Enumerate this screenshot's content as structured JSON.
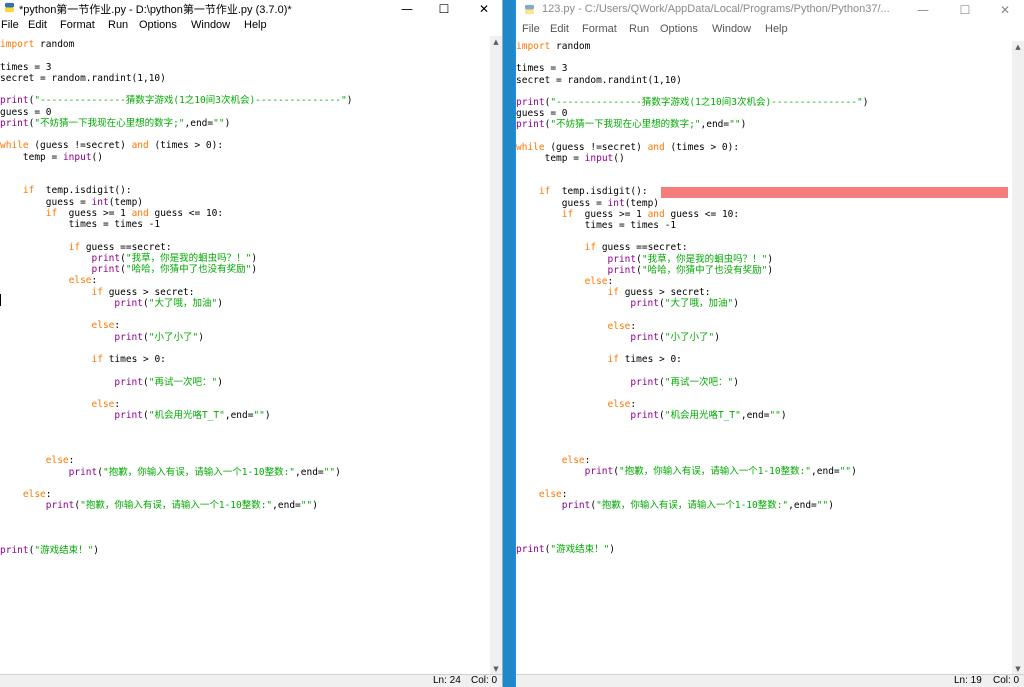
{
  "left_window": {
    "title": "*python第一节作业.py - D:\\python第一节作业.py (3.7.0)*",
    "menu": [
      "File",
      "Edit",
      "Format",
      "Run",
      "Options",
      "Window",
      "Help"
    ],
    "status_ln": "Ln: 24",
    "status_col": "Col: 0"
  },
  "right_window": {
    "title": "123.py - C:/Users/QWork/AppData/Local/Programs/Python/Python37/...",
    "menu": [
      "File",
      "Edit",
      "Format",
      "Run",
      "Options",
      "Window",
      "Help"
    ],
    "status_ln": "Ln: 19",
    "status_col": "Col: 0"
  },
  "window_controls": {
    "minimize": "—",
    "maximize": "☐",
    "close": "✕"
  },
  "scroll_arrows": {
    "up": "▲",
    "down": "▼"
  },
  "code_left": [
    {
      "indent": 0,
      "tokens": [
        [
          "kw",
          "import"
        ],
        [
          "n",
          " random"
        ]
      ]
    },
    {
      "indent": 0,
      "tokens": []
    },
    {
      "indent": 0,
      "tokens": [
        [
          "n",
          "times = 3"
        ]
      ]
    },
    {
      "indent": 0,
      "tokens": [
        [
          "n",
          "secret = random.randint(1,10)"
        ]
      ]
    },
    {
      "indent": 0,
      "tokens": []
    },
    {
      "indent": 0,
      "tokens": [
        [
          "bi",
          "print"
        ],
        [
          "n",
          "("
        ],
        [
          "st",
          "\"---------------猜数字游戏(1之10间3次机会)---------------\""
        ],
        [
          "n",
          ")"
        ]
      ]
    },
    {
      "indent": 0,
      "tokens": [
        [
          "n",
          "guess = 0"
        ]
      ]
    },
    {
      "indent": 0,
      "tokens": [
        [
          "bi",
          "print"
        ],
        [
          "n",
          "("
        ],
        [
          "st",
          "\"不妨猜一下我现在心里想的数字;\""
        ],
        [
          "n",
          ",end="
        ],
        [
          "st",
          "\"\""
        ],
        [
          "n",
          ")"
        ]
      ]
    },
    {
      "indent": 0,
      "tokens": []
    },
    {
      "indent": 0,
      "tokens": [
        [
          "kw",
          "while"
        ],
        [
          "n",
          " (guess !=secret) "
        ],
        [
          "kw",
          "and"
        ],
        [
          "n",
          " (times > 0):"
        ]
      ]
    },
    {
      "indent": 4,
      "tokens": [
        [
          "n",
          "temp = "
        ],
        [
          "bi",
          "input"
        ],
        [
          "n",
          "()"
        ]
      ]
    },
    {
      "indent": 0,
      "tokens": []
    },
    {
      "indent": 0,
      "tokens": []
    },
    {
      "indent": 4,
      "tokens": [
        [
          "kw",
          "if"
        ],
        [
          "n",
          "  temp.isdigit():"
        ]
      ]
    },
    {
      "indent": 8,
      "tokens": [
        [
          "n",
          "guess = "
        ],
        [
          "bi",
          "int"
        ],
        [
          "n",
          "(temp)"
        ]
      ]
    },
    {
      "indent": 8,
      "tokens": [
        [
          "kw",
          "if"
        ],
        [
          "n",
          "  guess >= 1 "
        ],
        [
          "kw",
          "and"
        ],
        [
          "n",
          " guess <= 10:"
        ]
      ]
    },
    {
      "indent": 12,
      "tokens": [
        [
          "n",
          "times = times -1"
        ]
      ]
    },
    {
      "indent": 0,
      "tokens": []
    },
    {
      "indent": 12,
      "tokens": [
        [
          "kw",
          "if"
        ],
        [
          "n",
          " guess ==secret:"
        ]
      ]
    },
    {
      "indent": 16,
      "tokens": [
        [
          "bi",
          "print"
        ],
        [
          "n",
          "("
        ],
        [
          "st",
          "\"我草，你是我的蛔虫吗？！\""
        ],
        [
          "n",
          ")"
        ]
      ]
    },
    {
      "indent": 16,
      "tokens": [
        [
          "bi",
          "print"
        ],
        [
          "n",
          "("
        ],
        [
          "st",
          "\"哈哈，你猜中了也没有奖励\""
        ],
        [
          "n",
          ")"
        ]
      ]
    },
    {
      "indent": 12,
      "tokens": [
        [
          "kw",
          "else"
        ],
        [
          "n",
          ":"
        ]
      ]
    },
    {
      "indent": 16,
      "tokens": [
        [
          "kw",
          "if"
        ],
        [
          "n",
          " guess > secret:"
        ]
      ]
    },
    {
      "indent": 20,
      "tokens": [
        [
          "bi",
          "print"
        ],
        [
          "n",
          "("
        ],
        [
          "st",
          "\"大了哦，加油\""
        ],
        [
          "n",
          ")"
        ]
      ]
    },
    {
      "indent": 0,
      "tokens": []
    },
    {
      "indent": 16,
      "tokens": [
        [
          "kw",
          "else"
        ],
        [
          "n",
          ":"
        ]
      ]
    },
    {
      "indent": 20,
      "tokens": [
        [
          "bi",
          "print"
        ],
        [
          "n",
          "("
        ],
        [
          "st",
          "\"小了小了\""
        ],
        [
          "n",
          ")"
        ]
      ]
    },
    {
      "indent": 0,
      "tokens": []
    },
    {
      "indent": 16,
      "tokens": [
        [
          "kw",
          "if"
        ],
        [
          "n",
          " times > 0:"
        ]
      ]
    },
    {
      "indent": 0,
      "tokens": []
    },
    {
      "indent": 20,
      "tokens": [
        [
          "bi",
          "print"
        ],
        [
          "n",
          "("
        ],
        [
          "st",
          "\"再试一次吧：\""
        ],
        [
          "n",
          ")"
        ]
      ]
    },
    {
      "indent": 0,
      "tokens": []
    },
    {
      "indent": 16,
      "tokens": [
        [
          "kw",
          "else"
        ],
        [
          "n",
          ":"
        ]
      ]
    },
    {
      "indent": 20,
      "tokens": [
        [
          "bi",
          "print"
        ],
        [
          "n",
          "("
        ],
        [
          "st",
          "\"机会用光咯T_T\""
        ],
        [
          "n",
          ",end="
        ],
        [
          "st",
          "\"\""
        ],
        [
          "n",
          ")"
        ]
      ]
    },
    {
      "indent": 0,
      "tokens": []
    },
    {
      "indent": 0,
      "tokens": []
    },
    {
      "indent": 0,
      "tokens": []
    },
    {
      "indent": 8,
      "tokens": [
        [
          "kw",
          "else"
        ],
        [
          "n",
          ":"
        ]
      ]
    },
    {
      "indent": 12,
      "tokens": [
        [
          "bi",
          "print"
        ],
        [
          "n",
          "("
        ],
        [
          "st",
          "\"抱歉，你输入有误，请输入一个1-10整数:\""
        ],
        [
          "n",
          ",end="
        ],
        [
          "st",
          "\"\""
        ],
        [
          "n",
          ")"
        ]
      ]
    },
    {
      "indent": 0,
      "tokens": []
    },
    {
      "indent": 4,
      "tokens": [
        [
          "kw",
          "else"
        ],
        [
          "n",
          ":"
        ]
      ]
    },
    {
      "indent": 8,
      "tokens": [
        [
          "bi",
          "print"
        ],
        [
          "n",
          "("
        ],
        [
          "st",
          "\"抱歉，你输入有误，请输入一个1-10整数:\""
        ],
        [
          "n",
          ",end="
        ],
        [
          "st",
          "\"\""
        ],
        [
          "n",
          ")"
        ]
      ]
    },
    {
      "indent": 0,
      "tokens": []
    },
    {
      "indent": 0,
      "tokens": []
    },
    {
      "indent": 0,
      "tokens": []
    },
    {
      "indent": 0,
      "tokens": [
        [
          "bi",
          "print"
        ],
        [
          "n",
          "("
        ],
        [
          "st",
          "\"游戏结束！\""
        ],
        [
          "n",
          ")"
        ]
      ]
    }
  ],
  "code_right": [
    {
      "indent": 0,
      "tokens": [
        [
          "kw",
          "import"
        ],
        [
          "n",
          " random"
        ]
      ]
    },
    {
      "indent": 0,
      "tokens": []
    },
    {
      "indent": 0,
      "tokens": [
        [
          "n",
          "times = 3"
        ]
      ]
    },
    {
      "indent": 0,
      "tokens": [
        [
          "n",
          "secret = random.randint(1,10)"
        ]
      ]
    },
    {
      "indent": 0,
      "tokens": []
    },
    {
      "indent": 0,
      "tokens": [
        [
          "bi",
          "print"
        ],
        [
          "n",
          "("
        ],
        [
          "st",
          "\"---------------猜数字游戏(1之10间3次机会)---------------\""
        ],
        [
          "n",
          ")"
        ]
      ]
    },
    {
      "indent": 0,
      "tokens": [
        [
          "n",
          "guess = 0"
        ]
      ]
    },
    {
      "indent": 0,
      "tokens": [
        [
          "bi",
          "print"
        ],
        [
          "n",
          "("
        ],
        [
          "st",
          "\"不妨猜一下我现在心里想的数字;\""
        ],
        [
          "n",
          ",end="
        ],
        [
          "st",
          "\"\""
        ],
        [
          "n",
          ")"
        ]
      ]
    },
    {
      "indent": 0,
      "tokens": []
    },
    {
      "indent": 0,
      "tokens": [
        [
          "kw",
          "while"
        ],
        [
          "n",
          " (guess !=secret) "
        ],
        [
          "kw",
          "and"
        ],
        [
          "n",
          " (times > 0):"
        ]
      ]
    },
    {
      "indent": 5,
      "tokens": [
        [
          "n",
          "temp = "
        ],
        [
          "bi",
          "input"
        ],
        [
          "n",
          "()"
        ]
      ]
    },
    {
      "indent": 0,
      "tokens": []
    },
    {
      "indent": 0,
      "tokens": []
    },
    {
      "indent": 4,
      "tokens": [
        [
          "kw",
          "if"
        ],
        [
          "n",
          "  temp.isdigit():"
        ]
      ]
    },
    {
      "indent": 8,
      "tokens": [
        [
          "n",
          "guess = "
        ],
        [
          "bi",
          "int"
        ],
        [
          "n",
          "(temp)"
        ]
      ]
    },
    {
      "indent": 8,
      "tokens": [
        [
          "kw",
          "if"
        ],
        [
          "n",
          "  guess >= 1 "
        ],
        [
          "kw",
          "and"
        ],
        [
          "n",
          " guess <= 10:"
        ]
      ]
    },
    {
      "indent": 12,
      "tokens": [
        [
          "n",
          "times = times -1"
        ]
      ]
    },
    {
      "indent": 0,
      "tokens": []
    },
    {
      "indent": 12,
      "tokens": [
        [
          "kw",
          "if"
        ],
        [
          "n",
          " guess ==secret:"
        ]
      ]
    },
    {
      "indent": 16,
      "tokens": [
        [
          "bi",
          "print"
        ],
        [
          "n",
          "("
        ],
        [
          "st",
          "\"我草，你是我的蛔虫吗？！\""
        ],
        [
          "n",
          ")"
        ]
      ]
    },
    {
      "indent": 16,
      "tokens": [
        [
          "bi",
          "print"
        ],
        [
          "n",
          "("
        ],
        [
          "st",
          "\"哈哈，你猜中了也没有奖励\""
        ],
        [
          "n",
          ")"
        ]
      ]
    },
    {
      "indent": 12,
      "tokens": [
        [
          "kw",
          "else"
        ],
        [
          "n",
          ":"
        ]
      ]
    },
    {
      "indent": 16,
      "tokens": [
        [
          "kw",
          "if"
        ],
        [
          "n",
          " guess > secret:"
        ]
      ]
    },
    {
      "indent": 20,
      "tokens": [
        [
          "bi",
          "print"
        ],
        [
          "n",
          "("
        ],
        [
          "st",
          "\"大了哦，加油\""
        ],
        [
          "n",
          ")"
        ]
      ]
    },
    {
      "indent": 0,
      "tokens": []
    },
    {
      "indent": 16,
      "tokens": [
        [
          "kw",
          "else"
        ],
        [
          "n",
          ":"
        ]
      ]
    },
    {
      "indent": 20,
      "tokens": [
        [
          "bi",
          "print"
        ],
        [
          "n",
          "("
        ],
        [
          "st",
          "\"小了小了\""
        ],
        [
          "n",
          ")"
        ]
      ]
    },
    {
      "indent": 0,
      "tokens": []
    },
    {
      "indent": 16,
      "tokens": [
        [
          "kw",
          "if"
        ],
        [
          "n",
          " times > 0:"
        ]
      ]
    },
    {
      "indent": 0,
      "tokens": []
    },
    {
      "indent": 20,
      "tokens": [
        [
          "bi",
          "print"
        ],
        [
          "n",
          "("
        ],
        [
          "st",
          "\"再试一次吧：\""
        ],
        [
          "n",
          ")"
        ]
      ]
    },
    {
      "indent": 0,
      "tokens": []
    },
    {
      "indent": 16,
      "tokens": [
        [
          "kw",
          "else"
        ],
        [
          "n",
          ":"
        ]
      ]
    },
    {
      "indent": 20,
      "tokens": [
        [
          "bi",
          "print"
        ],
        [
          "n",
          "("
        ],
        [
          "st",
          "\"机会用光咯T_T\""
        ],
        [
          "n",
          ",end="
        ],
        [
          "st",
          "\"\""
        ],
        [
          "n",
          ")"
        ]
      ]
    },
    {
      "indent": 0,
      "tokens": []
    },
    {
      "indent": 0,
      "tokens": []
    },
    {
      "indent": 0,
      "tokens": []
    },
    {
      "indent": 8,
      "tokens": [
        [
          "kw",
          "else"
        ],
        [
          "n",
          ":"
        ]
      ]
    },
    {
      "indent": 12,
      "tokens": [
        [
          "bi",
          "print"
        ],
        [
          "n",
          "("
        ],
        [
          "st",
          "\"抱歉，你输入有误，请输入一个1-10整数:\""
        ],
        [
          "n",
          ",end="
        ],
        [
          "st",
          "\"\""
        ],
        [
          "n",
          ")"
        ]
      ]
    },
    {
      "indent": 0,
      "tokens": []
    },
    {
      "indent": 4,
      "tokens": [
        [
          "kw",
          "else"
        ],
        [
          "n",
          ":"
        ]
      ]
    },
    {
      "indent": 8,
      "tokens": [
        [
          "bi",
          "print"
        ],
        [
          "n",
          "("
        ],
        [
          "st",
          "\"抱歉，你输入有误，请输入一个1-10整数:\""
        ],
        [
          "n",
          ",end="
        ],
        [
          "st",
          "\"\""
        ],
        [
          "n",
          ")"
        ]
      ]
    },
    {
      "indent": 0,
      "tokens": []
    },
    {
      "indent": 0,
      "tokens": []
    },
    {
      "indent": 0,
      "tokens": []
    },
    {
      "indent": 0,
      "tokens": [
        [
          "bi",
          "print"
        ],
        [
          "n",
          "("
        ],
        [
          "st",
          "\"游戏结束！\""
        ],
        [
          "n",
          ")"
        ]
      ]
    }
  ],
  "colors": {
    "keyword": "#ff7700",
    "builtin": "#900090",
    "string": "#00aa00",
    "error_highlight": "#f47c7c",
    "desktop": "#1e88c8"
  }
}
